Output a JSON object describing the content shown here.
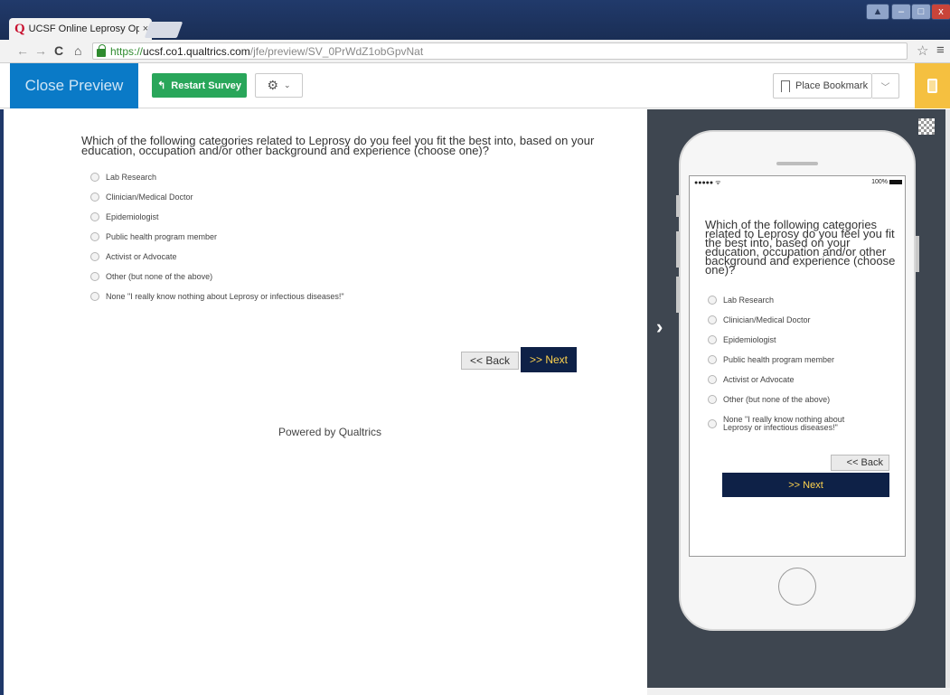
{
  "browser": {
    "tab_title": "UCSF Online Leprosy Opir",
    "tab_logo": "Q",
    "tab_close": "×",
    "url_scheme": "https://",
    "url_host": "ucsf.co1.qualtrics.com",
    "url_path": "/jfe/preview/SV_0PrWdZ1obGpvNat",
    "icons": [
      "back-icon",
      "forward-icon",
      "reload-icon",
      "home-icon",
      "lock-icon",
      "star-icon",
      "menu-icon"
    ]
  },
  "preview_header": {
    "close_label": "Close Preview",
    "restart_label": "Restart Survey",
    "bookmark_label": "Place Bookmark",
    "colors": {
      "close_bg": "#0a7ac7",
      "restart_bg": "#29a65a",
      "mobile_toggle_bg": "#f5c040"
    }
  },
  "survey": {
    "question": "Which of the following categories related to Leprosy do you feel you fit the best into, based on your education, occupation and/or other background and experience (choose one)?",
    "choices": [
      "Lab Research",
      "Clinician/Medical Doctor",
      "Epidemiologist",
      "Public health program member",
      "Activist or Advocate",
      "Other (but none of the above)",
      "None \"I really know nothing about Leprosy or infectious diseases!\""
    ],
    "back_label": "<< Back",
    "next_label": ">> Next",
    "powered_by": "Powered by Qualtrics",
    "colors": {
      "next_bg": "#0e2147",
      "next_text": "#ffd34e"
    }
  },
  "mobile": {
    "signal": "●●●●● ᯤ",
    "battery": "100%",
    "collapse_arrow": "›"
  }
}
